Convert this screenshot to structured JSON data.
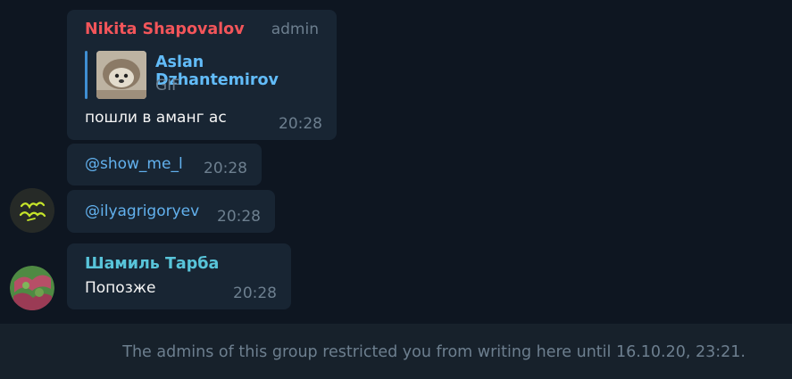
{
  "messages": [
    {
      "sender": "Nikita Shapovalov",
      "role": "admin",
      "reply": {
        "author": "Aslan Dzhantemirov",
        "type": "GIF"
      },
      "text": "пошли в аманг ас",
      "time": "20:28"
    },
    {
      "text": "@show_me_l",
      "time": "20:28"
    },
    {
      "text": "@ilyagrigoryev",
      "time": "20:28"
    },
    {
      "sender": "Шамиль Тарба",
      "text": "Попозже",
      "time": "20:28"
    }
  ],
  "footer": {
    "notice": "The admins of this group restricted you from writing here until 16.10.20, 23:21."
  },
  "colors": {
    "background": "#0e1621",
    "bubble": "#182533",
    "footer": "#17212b",
    "sender_red": "#f2555a",
    "sender_teal": "#58c4d9",
    "link": "#62b1ee"
  }
}
